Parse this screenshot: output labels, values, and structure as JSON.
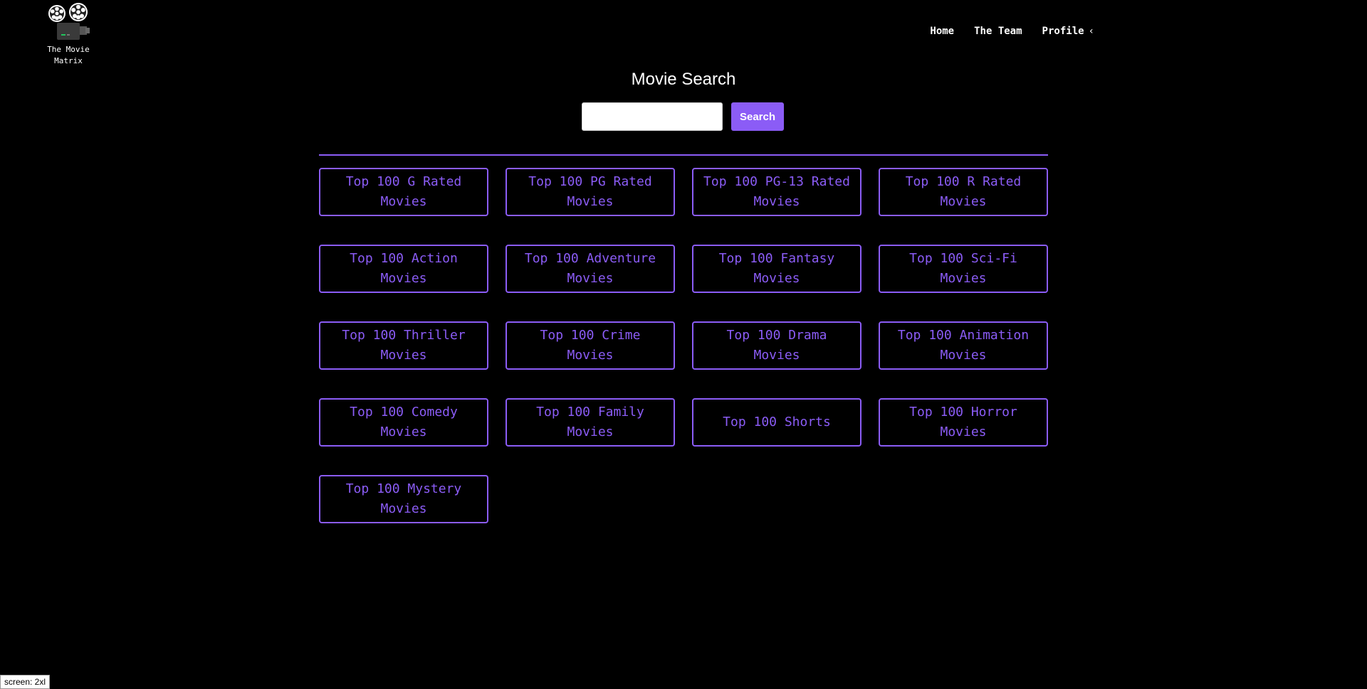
{
  "brand": {
    "name": "The Movie Matrix",
    "logo_icon": "film-projector-icon"
  },
  "nav": {
    "items": [
      {
        "label": "Home"
      },
      {
        "label": "The Team"
      },
      {
        "label": "Profile"
      }
    ],
    "profile_chevron": "‹"
  },
  "search": {
    "title": "Movie Search",
    "input_value": "",
    "button_label": "Search"
  },
  "categories": [
    {
      "label": "Top 100 G Rated Movies"
    },
    {
      "label": "Top 100 PG Rated Movies"
    },
    {
      "label": "Top 100 PG-13 Rated Movies"
    },
    {
      "label": "Top 100 R Rated Movies"
    },
    {
      "label": "Top 100 Action Movies"
    },
    {
      "label": "Top 100 Adventure Movies"
    },
    {
      "label": "Top 100 Fantasy Movies"
    },
    {
      "label": "Top 100 Sci-Fi Movies"
    },
    {
      "label": "Top 100 Thriller Movies"
    },
    {
      "label": "Top 100 Crime Movies"
    },
    {
      "label": "Top 100 Drama Movies"
    },
    {
      "label": "Top 100 Animation Movies"
    },
    {
      "label": "Top 100 Comedy Movies"
    },
    {
      "label": "Top 100 Family Movies"
    },
    {
      "label": "Top 100 Shorts"
    },
    {
      "label": "Top 100 Horror Movies"
    },
    {
      "label": "Top 100 Mystery Movies"
    }
  ],
  "screen_indicator": "screen: 2xl",
  "colors": {
    "accent": "#8b5cf6",
    "background": "#000000",
    "text": "#ffffff"
  }
}
